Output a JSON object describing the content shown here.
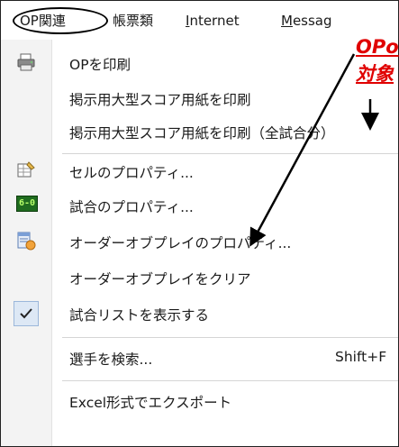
{
  "menubar": {
    "items": [
      {
        "label": "OP関連",
        "mnemonic": "",
        "rest": ""
      },
      {
        "label": "帳票類",
        "mnemonic": "",
        "rest": ""
      },
      {
        "label": "",
        "mnemonic": "I",
        "rest": "nternet"
      },
      {
        "label": "",
        "mnemonic": "M",
        "rest": "essag"
      }
    ]
  },
  "menu": {
    "items": [
      {
        "label": "OPを印刷",
        "icon": "printer-icon"
      },
      {
        "label": "掲示用大型スコア用紙を印刷"
      },
      {
        "label": "掲示用大型スコア用紙を印刷（全試合分）"
      },
      {
        "label": "セルのプロパティ...",
        "icon": "cell-properties-icon"
      },
      {
        "label": "試合のプロパティ...",
        "icon": "match-properties-icon",
        "icon_text": "6-0"
      },
      {
        "label": "オーダーオブプレイのプロパティ...",
        "icon": "order-of-play-icon"
      },
      {
        "label": "オーダーオブプレイをクリア"
      },
      {
        "label": "試合リストを表示する",
        "icon": "checkmark-icon",
        "checked": true
      },
      {
        "label": "選手を検索...",
        "shortcut": "Shift+F"
      },
      {
        "label": "Excel形式でエクスポート"
      }
    ]
  },
  "annotation": {
    "line1": "OPo",
    "line2": "対象",
    "color": "#e00000"
  }
}
